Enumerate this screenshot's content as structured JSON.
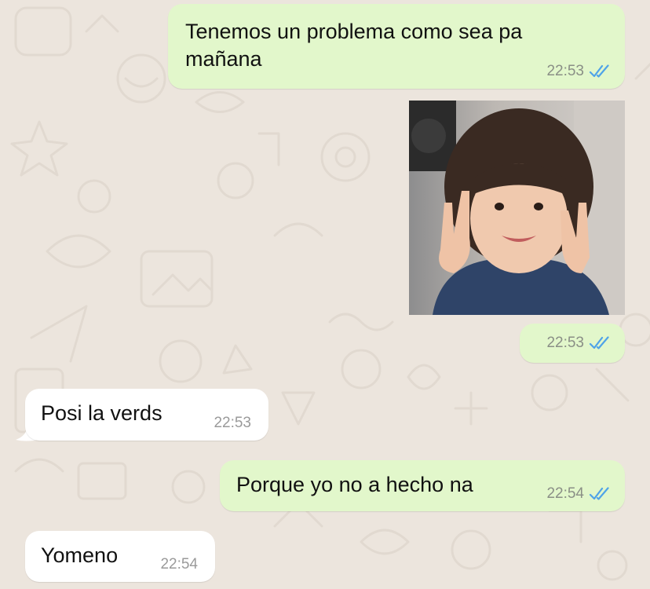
{
  "chat": {
    "messages": [
      {
        "direction": "outgoing",
        "text": "Tenemos un problema como sea pa",
        "text2": "mañana",
        "time": "22:53",
        "status": "read"
      },
      {
        "direction": "outgoing",
        "type": "image",
        "time": "22:53",
        "status": "read",
        "image_description": "child making rock hand gesture"
      },
      {
        "direction": "incoming",
        "text": "Posi la verds",
        "time": "22:53"
      },
      {
        "direction": "outgoing",
        "text": "Porque yo no a hecho na",
        "time": "22:54",
        "status": "read"
      },
      {
        "direction": "incoming",
        "text": "Yomeno",
        "time": "22:54"
      }
    ]
  },
  "colors": {
    "outgoing_bubble": "#e2f7cb",
    "incoming_bubble": "#ffffff",
    "background": "#ece5dd",
    "read_ticks": "#4fa3e8"
  },
  "icons": {
    "read_receipt": "double-check-icon"
  }
}
